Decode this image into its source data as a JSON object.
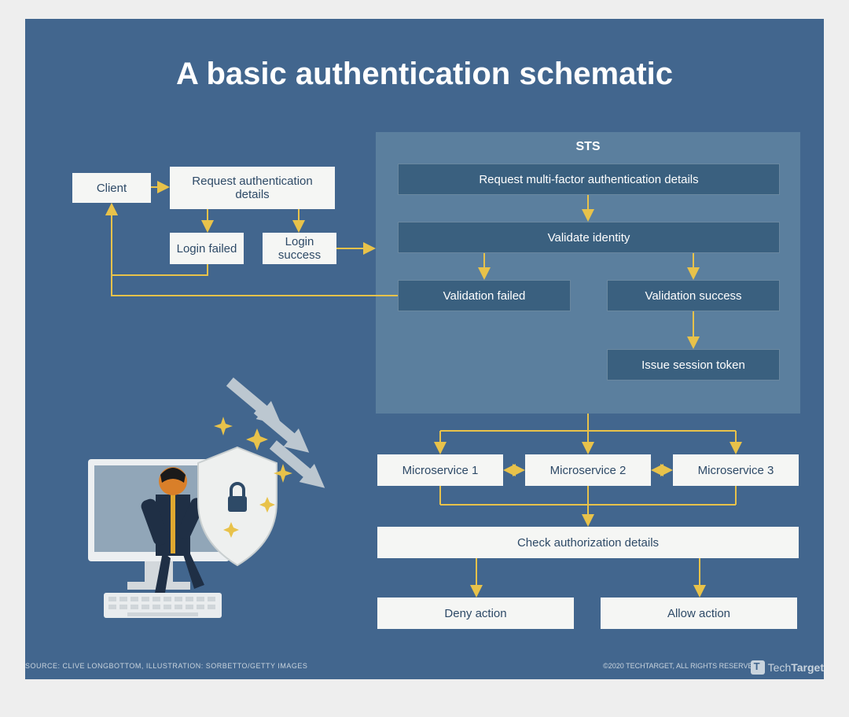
{
  "title": "A basic authentication schematic",
  "boxes": {
    "client": "Client",
    "request_auth": "Request authentication details",
    "login_failed": "Login failed",
    "login_success": "Login success",
    "sts_title": "STS",
    "mfa": "Request multi-factor authentication details",
    "validate_identity": "Validate identity",
    "validation_failed": "Validation failed",
    "validation_success": "Validation success",
    "issue_token": "Issue session token",
    "ms1": "Microservice 1",
    "ms2": "Microservice 2",
    "ms3": "Microservice 3",
    "check_auth": "Check authorization details",
    "deny": "Deny action",
    "allow": "Allow action"
  },
  "footer": {
    "source": "SOURCE: CLIVE LONGBOTTOM, ILLUSTRATION: SORBETTO/GETTY IMAGES",
    "copyright": "©2020 TECHTARGET, ALL RIGHTS RESERVED",
    "logo_text": "TechTarget"
  },
  "colors": {
    "canvas": "#42668e",
    "sts_panel": "#5b7f9e",
    "dark_box": "#3a607f",
    "light_box": "#f5f6f4",
    "arrow": "#e8c24a"
  }
}
